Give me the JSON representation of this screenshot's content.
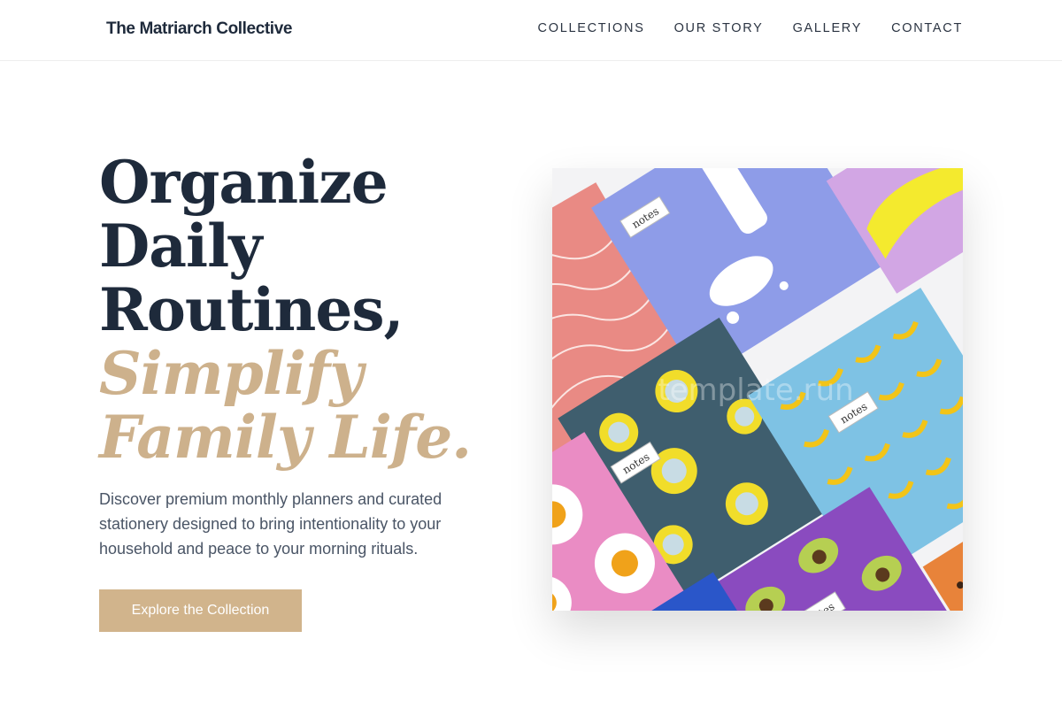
{
  "header": {
    "brand": "The Matriarch Collective",
    "nav": [
      {
        "label": "COLLECTIONS"
      },
      {
        "label": "OUR STORY"
      },
      {
        "label": "GALLERY"
      },
      {
        "label": "CONTACT"
      }
    ]
  },
  "hero": {
    "title_lines": [
      "Organize",
      "Daily",
      "Routines,"
    ],
    "accent_lines": [
      "Simplify",
      "Family Life."
    ],
    "description": "Discover premium monthly planners and curated stationery designed to bring intentionality to your household and peace to your morning rituals.",
    "cta_label": "Explore the Collection",
    "image": {
      "notebook_label": "notes",
      "watermark": "template.run"
    }
  },
  "colors": {
    "navy": "#1e2a3b",
    "accent_gold": "#cdb18c",
    "button_bg": "#d1b48c",
    "body_text": "#4a5566"
  }
}
